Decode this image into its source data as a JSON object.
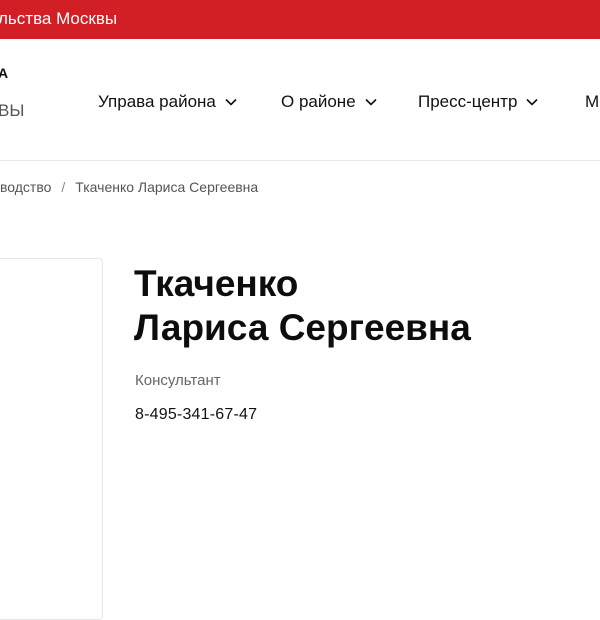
{
  "top_bar": {
    "text": "льства Москвы"
  },
  "header": {
    "logo_line1": "А",
    "logo_line2": "ВЫ",
    "nav": [
      {
        "label": "Управа района"
      },
      {
        "label": "О районе"
      },
      {
        "label": "Пресс-центр"
      },
      {
        "label": "М"
      }
    ]
  },
  "breadcrumb": {
    "parent": "водство",
    "separator": "/",
    "current": "Ткаченко Лариса Сергеевна"
  },
  "person": {
    "last_name": "Ткаченко",
    "first_middle": "Лариса Сергеевна",
    "position": "Консультант",
    "phone": "8-495-341-67-47"
  },
  "colors": {
    "brand_red": "#d21f26",
    "text_primary": "#111111",
    "text_secondary": "#666666"
  },
  "icons": {
    "nav_dropdown": "chevron-down-icon"
  }
}
